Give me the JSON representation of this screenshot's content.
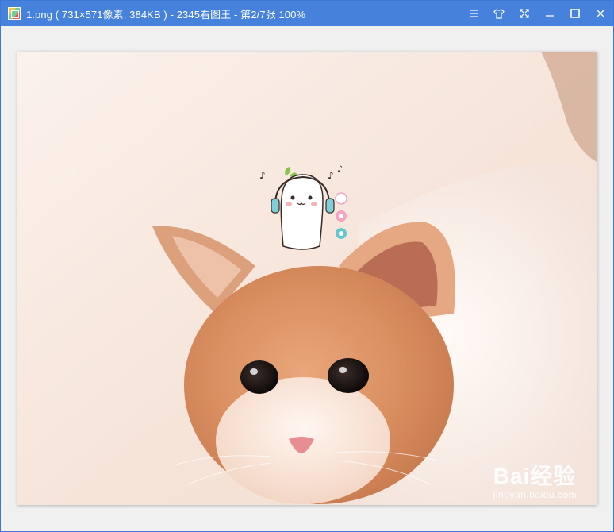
{
  "window": {
    "title": "1.png ( 731×571像素, 384KB ) - 2345看图王 - 第2/7张 100%",
    "app_icon": "image-viewer-app-icon",
    "controls": {
      "menu_icon": "menu-icon",
      "skin_icon": "shirt-icon",
      "fullscreen_icon": "fullscreen-icon",
      "minimize_icon": "minimize-icon",
      "maximize_icon": "maximize-icon",
      "close_icon": "close-icon"
    }
  },
  "image": {
    "description_icon": "kitten-photo",
    "watermark": {
      "brand_text": "Bai经验",
      "url": "jingyan.baidu.com"
    }
  },
  "colors": {
    "titlebar": "#4682db",
    "background": "#f0f0f0"
  }
}
